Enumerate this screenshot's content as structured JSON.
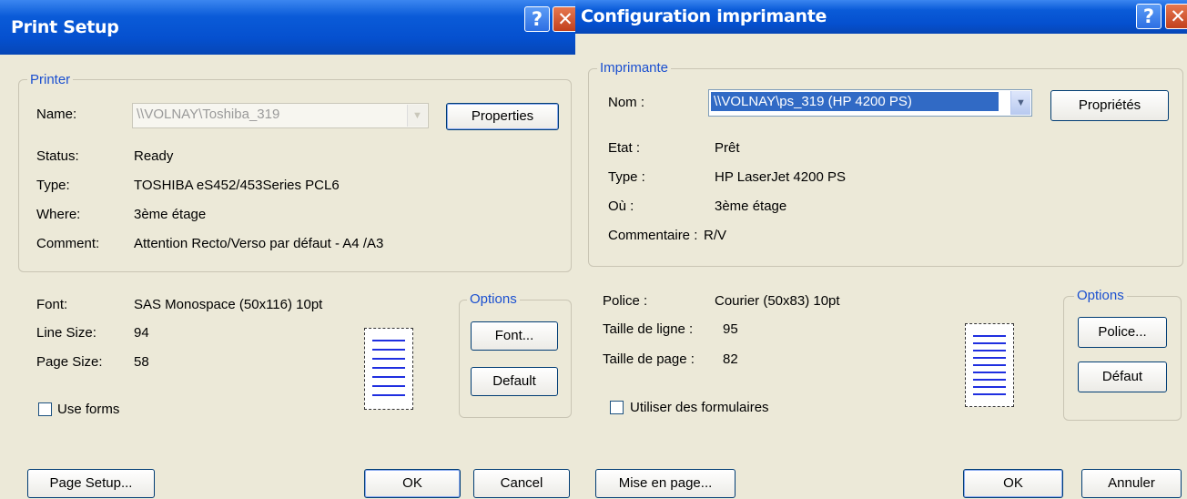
{
  "left": {
    "title": "Print Setup",
    "help_icon": "?",
    "close_icon": "✕",
    "printer_group": "Printer",
    "name_label": "Name:",
    "name_value": "\\\\VOLNAY\\Toshiba_319",
    "properties_button": "Properties",
    "status_label": "Status:",
    "status_value": "Ready",
    "type_label": "Type:",
    "type_value": "TOSHIBA eS452/453Series PCL6",
    "where_label": "Where:",
    "where_value": "3ème étage",
    "comment_label": "Comment:",
    "comment_value": "Attention Recto/Verso par défaut - A4 /A3",
    "font_label": "Font:",
    "font_value": "SAS Monospace (50x116) 10pt",
    "line_size_label": "Line Size:",
    "line_size_value": "94",
    "page_size_label": "Page Size:",
    "page_size_value": "58",
    "options_group": "Options",
    "font_button": "Font...",
    "default_button": "Default",
    "use_forms_label": "Use forms",
    "page_setup_button": "Page Setup...",
    "ok_button": "OK",
    "cancel_button": "Cancel"
  },
  "right": {
    "title": "Configuration imprimante",
    "help_icon": "?",
    "close_icon": "✕",
    "printer_group": "Imprimante",
    "name_label": "Nom :",
    "name_value": "\\\\VOLNAY\\ps_319 (HP 4200 PS)",
    "properties_button": "Propriétés",
    "status_label": "Etat :",
    "status_value": "Prêt",
    "type_label": "Type :",
    "type_value": "HP LaserJet 4200 PS",
    "where_label": "Où :",
    "where_value": "3ème étage",
    "comment_label": "Commentaire :",
    "comment_value": "R/V",
    "font_label": "Police :",
    "font_value": "Courier (50x83) 10pt",
    "line_size_label": "Taille de ligne :",
    "line_size_value": "95",
    "page_size_label": "Taille de page :",
    "page_size_value": "82",
    "options_group": "Options",
    "font_button": "Police...",
    "default_button": "Défaut",
    "use_forms_label": "Utiliser des formulaires",
    "page_setup_button": "Mise en page...",
    "ok_button": "OK",
    "cancel_button": "Annuler"
  },
  "colors": {
    "titlebar": "#0550cf",
    "dialog_bg": "#ECE9D8",
    "group_label": "#1a4fd0",
    "selection": "#316ac5",
    "close_button": "#c2411d"
  },
  "icons": [
    "help-icon",
    "close-icon",
    "chevron-down-icon",
    "page-preview-icon"
  ]
}
